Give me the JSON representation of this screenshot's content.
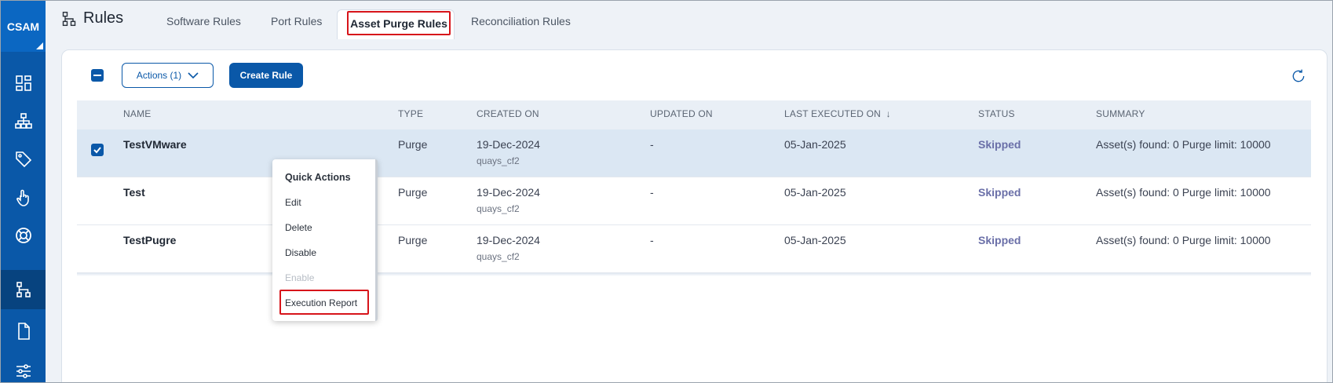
{
  "app": {
    "brand": "CSAM"
  },
  "sidebar": {
    "items": [
      {
        "icon": "dashboard-icon"
      },
      {
        "icon": "hierarchy-icon"
      },
      {
        "icon": "tag-icon"
      },
      {
        "icon": "touch-icon"
      },
      {
        "icon": "lifebuoy-icon"
      },
      {
        "icon": "rules-icon",
        "active": true
      },
      {
        "icon": "document-icon"
      },
      {
        "icon": "sliders-icon"
      }
    ]
  },
  "header": {
    "title": "Rules",
    "tabs": [
      {
        "label": "Software Rules"
      },
      {
        "label": "Port Rules"
      },
      {
        "label": "Asset Purge Rules",
        "active": true
      },
      {
        "label": "Reconciliation Rules"
      }
    ]
  },
  "toolbar": {
    "actions_label": "Actions (1)",
    "create_label": "Create Rule"
  },
  "table": {
    "columns": [
      "NAME",
      "TYPE",
      "CREATED ON",
      "UPDATED ON",
      "LAST EXECUTED ON",
      "STATUS",
      "SUMMARY"
    ],
    "rows": [
      {
        "name": "TestVMware",
        "type": "Purge",
        "created_on": "19-Dec-2024",
        "created_by": "quays_cf2",
        "updated_on": "-",
        "last_executed_on": "05-Jan-2025",
        "status": "Skipped",
        "summary": "Asset(s) found: 0 Purge limit: 10000",
        "selected": true
      },
      {
        "name": "Test",
        "type": "Purge",
        "created_on": "19-Dec-2024",
        "created_by": "quays_cf2",
        "updated_on": "-",
        "last_executed_on": "05-Jan-2025",
        "status": "Skipped",
        "summary": "Asset(s) found: 0 Purge limit: 10000",
        "selected": false
      },
      {
        "name": "TestPugre",
        "type": "Purge",
        "created_on": "19-Dec-2024",
        "created_by": "quays_cf2",
        "updated_on": "-",
        "last_executed_on": "05-Jan-2025",
        "status": "Skipped",
        "summary": "Asset(s) found: 0 Purge limit: 10000",
        "selected": false
      }
    ]
  },
  "quick_actions": {
    "title": "Quick Actions",
    "items": [
      {
        "label": "Edit",
        "enabled": true
      },
      {
        "label": "Delete",
        "enabled": true
      },
      {
        "label": "Disable",
        "enabled": true
      },
      {
        "label": "Enable",
        "enabled": false
      },
      {
        "label": "Execution Report",
        "enabled": true,
        "highlighted": true
      }
    ]
  },
  "colors": {
    "primary": "#0a58a8",
    "highlight": "#d7141a",
    "status_skipped": "#6a6fa8"
  }
}
